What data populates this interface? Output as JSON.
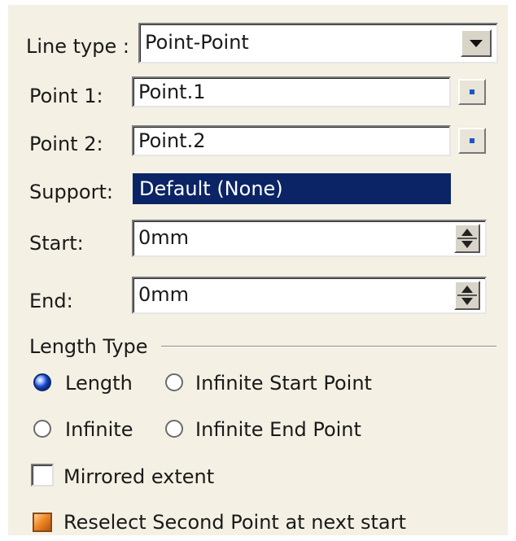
{
  "line_type": {
    "label": "Line type :",
    "value": "Point-Point"
  },
  "point1": {
    "label": "Point 1:",
    "value": "Point.1"
  },
  "point2": {
    "label": "Point 2:",
    "value": "Point.2"
  },
  "support": {
    "label": "Support:",
    "value": "Default (None)"
  },
  "start": {
    "label": "Start:",
    "value": "0mm"
  },
  "end": {
    "label": "End:",
    "value": "0mm"
  },
  "length_type": {
    "title": "Length Type",
    "options": [
      {
        "label": "Length",
        "selected": true
      },
      {
        "label": "Infinite Start Point",
        "selected": false
      },
      {
        "label": "Infinite",
        "selected": false
      },
      {
        "label": "Infinite End Point",
        "selected": false
      }
    ]
  },
  "mirrored_extent": {
    "label": "Mirrored extent",
    "checked": false
  },
  "reselect": {
    "label": "Reselect Second Point at next start",
    "checked": true
  },
  "colors": {
    "panel_bg": "#f4f0e4",
    "selection_bg": "#0a2466",
    "radio_on": "#1e48c8",
    "reselect_check": "#f08a2a"
  },
  "icons": {
    "dropdown": "chevron-down-icon",
    "point_picker": "point-select-icon",
    "spinner": "spin-up-down-icon"
  }
}
